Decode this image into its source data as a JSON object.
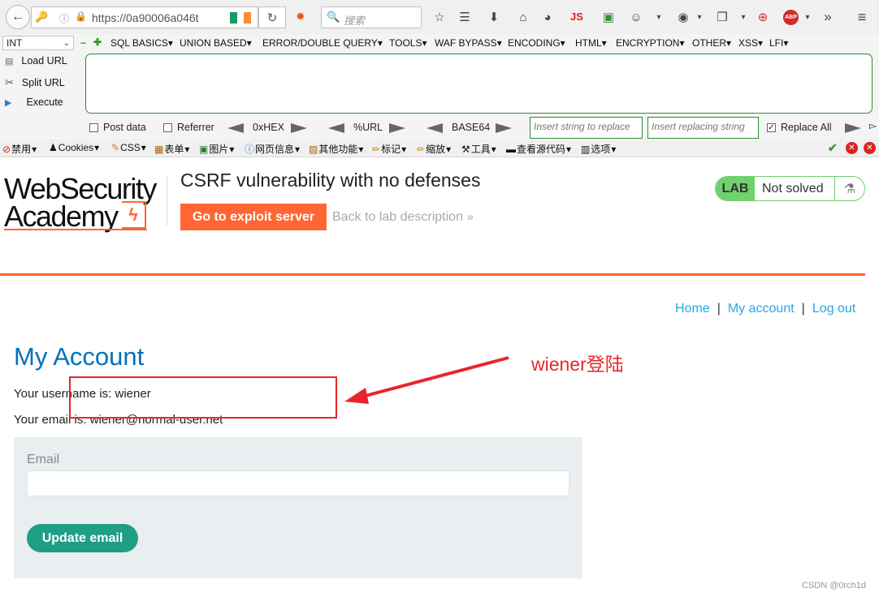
{
  "browser": {
    "url": "https://0a90006a046t",
    "search_placeholder": "搜索",
    "js_label": "JS",
    "abp_label": "ABP"
  },
  "hackbar": {
    "select_value": "INT",
    "menu": [
      "SQL BASICS",
      "UNION BASED",
      "ERROR/DOUBLE QUERY",
      "TOOLS",
      "WAF BYPASS",
      "ENCODING",
      "HTML",
      "ENCRYPTION",
      "OTHER",
      "XSS",
      "LFI"
    ],
    "load_url": "Load URL",
    "split_url": "Split URL",
    "execute": "Execute",
    "post_data": "Post data",
    "referrer": "Referrer",
    "hex": "0xHEX",
    "url_enc": "%URL",
    "base64": "BASE64",
    "replace_placeholder": "Insert string to replace",
    "replacing_placeholder": "Insert replacing string",
    "replace_all": "Replace All"
  },
  "toolbar2": [
    "禁用",
    "Cookies",
    "CSS",
    "表单",
    "图片",
    "网页信息",
    "其他功能",
    "标记",
    "缩放",
    "工具",
    "查看源代码",
    "选项"
  ],
  "lab": {
    "logo_line1": "WebSecurity",
    "logo_line2": "Academy",
    "title": "CSRF vulnerability with no defenses",
    "exploit_button": "Go to exploit server",
    "back_link": "Back to lab description",
    "badge_lab": "LAB",
    "badge_status": "Not solved"
  },
  "nav": {
    "home": "Home",
    "my_account": "My account",
    "log_out": "Log out",
    "sep": "|"
  },
  "account": {
    "heading": "My Account",
    "username_line": "Your username is: wiener",
    "email_line": "Your email is: wiener@normal-user.net",
    "email_label": "Email",
    "email_value": "",
    "update_button": "Update email"
  },
  "annotation": {
    "text": "wiener登陆",
    "color": "#e8252c"
  },
  "watermark": "CSDN @0rch1d",
  "colors": {
    "orange": "#ff6633",
    "blue": "#0071bc",
    "link": "#29a7df",
    "teal": "#1f9e86",
    "green_badge": "#70d16d"
  }
}
